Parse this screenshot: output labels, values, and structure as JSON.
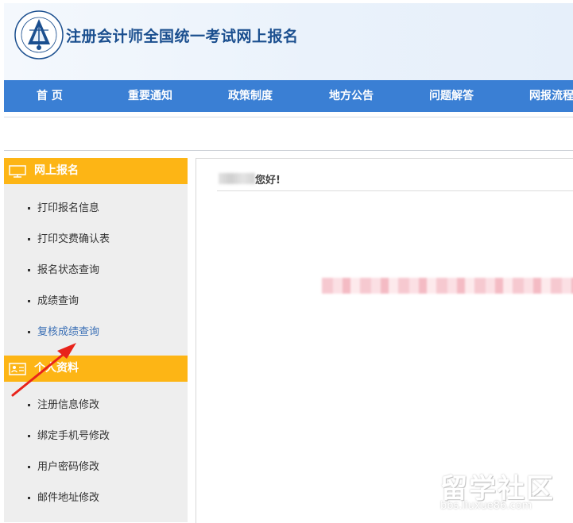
{
  "header": {
    "title": "注册会计师全国统一考试网上报名",
    "logo_icon": "cicpa-logo-icon"
  },
  "nav": {
    "items": [
      {
        "label": "首 页"
      },
      {
        "label": "重要通知"
      },
      {
        "label": "政策制度"
      },
      {
        "label": "地方公告"
      },
      {
        "label": "问题解答"
      },
      {
        "label": "网报流程"
      }
    ]
  },
  "sidebar": {
    "section1": {
      "title": "网上报名",
      "icon": "monitor-icon",
      "items": [
        {
          "label": "打印报名信息"
        },
        {
          "label": "打印交费确认表"
        },
        {
          "label": "报名状态查询"
        },
        {
          "label": "成绩查询"
        },
        {
          "label": "复核成绩查询"
        }
      ]
    },
    "section2": {
      "title": "个人资料",
      "icon": "id-card-icon",
      "items": [
        {
          "label": "注册信息修改"
        },
        {
          "label": "绑定手机号修改"
        },
        {
          "label": "用户密码修改"
        },
        {
          "label": "邮件地址修改"
        }
      ]
    }
  },
  "main": {
    "greeting": "您好!"
  },
  "annotation": {
    "arrow_color": "#e8231b"
  },
  "watermark": {
    "text": "留学社区",
    "url": "bbs.liuxue86.com"
  },
  "colors": {
    "nav_bg": "#3a7fd4",
    "section_header": "#fdb515",
    "sidebar_bg": "#eeeeee",
    "active_link": "#3a6fb5"
  }
}
